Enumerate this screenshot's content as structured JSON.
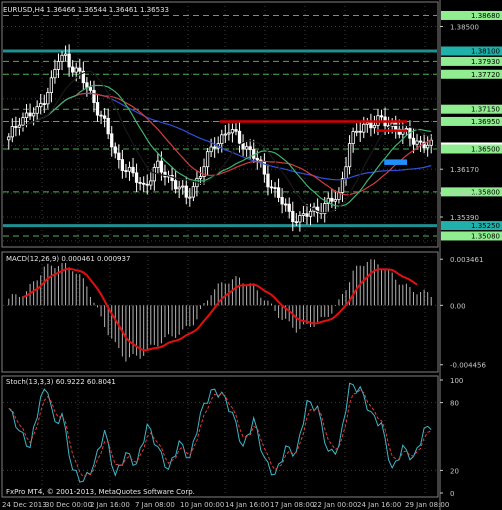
{
  "header": {
    "symbol_line": "EURUSD,H4  1.36466 1.36544 1.36461 1.36533"
  },
  "copyright": "FxPro MT4, © 2001-2013, MetaQuotes Software Corp.",
  "colors": {
    "background": "#000000",
    "grid": "#3c3c3c",
    "candle": "#ffffff",
    "level_teal": "#1f8f8f",
    "level_red": "#d40000",
    "zone_blue": "#1e90ff",
    "ma_red": "#d23c3c",
    "ma_blue": "#3050d8",
    "ma_green": "#3cb371",
    "ma_black": "#181818",
    "dashed_green": "#4caf50",
    "macd_hist": "#b4b4b4",
    "macd_signal": "#e01010",
    "stoch_main": "#3fb6c8",
    "stoch_signal": "#e03c3c"
  },
  "chart_data": [
    {
      "type": "candlestick",
      "panel": "price",
      "title": "EURUSD,H4",
      "ylim": [
        1.349,
        1.389
      ],
      "ticks_shown": [
        "1.38500",
        "1.36170",
        "1.35780",
        "1.35390"
      ],
      "price_boxes": [
        {
          "label": "1.38680",
          "color": "#90ee90"
        },
        {
          "label": "1.38100",
          "color": "#20b2aa"
        },
        {
          "label": "1.37930",
          "color": "#90ee90"
        },
        {
          "label": "1.37720",
          "color": "#90ee90"
        },
        {
          "label": "1.37150",
          "color": "#90ee90"
        },
        {
          "label": "1.36950",
          "color": "#90ee90"
        },
        {
          "label": "1.36533",
          "color": "#ffffff"
        },
        {
          "label": "1.36500",
          "color": "#90ee90"
        },
        {
          "label": "1.35800",
          "color": "#90ee90"
        },
        {
          "label": "1.35250",
          "color": "#20b2aa"
        },
        {
          "label": "1.35080",
          "color": "#90ee90"
        }
      ],
      "levels": [
        {
          "kind": "horizontal",
          "value": 1.381,
          "style": "solid",
          "color": "teal"
        },
        {
          "kind": "horizontal",
          "value": 1.3525,
          "style": "solid",
          "color": "teal"
        },
        {
          "kind": "segment",
          "value": 1.3695,
          "from": "14 Jan",
          "style": "solid",
          "color": "red"
        },
        {
          "kind": "segment",
          "value": 1.368,
          "from": "22 Jan",
          "style": "solid",
          "color": "red"
        },
        {
          "kind": "zone",
          "from_value": 1.3632,
          "to_value": 1.3625,
          "color": "blue"
        }
      ],
      "dashed_levels": [
        1.3868,
        1.3793,
        1.3772,
        1.3715,
        1.3695,
        1.365,
        1.358,
        1.3508
      ],
      "x_labels": [
        "24 Dec 2013",
        "30 Dec 00:00",
        "2 Jan 16:00",
        "7 Jan 08:00",
        "10 Jan 00:00",
        "14 Jan 16:00",
        "17 Jan 08:00",
        "22 Jan 00:00",
        "24 Jan 16:00",
        "29 Jan 08:00"
      ]
    },
    {
      "type": "line",
      "panel": "macd",
      "title": "MACD(12,26,9) 0.000461 0.000937",
      "ticks_shown": [
        "0.003461",
        "0.00",
        "-0.004456"
      ],
      "ylim": [
        -0.005,
        0.004
      ],
      "series": [
        {
          "name": "MACD",
          "kind": "histogram"
        },
        {
          "name": "Signal",
          "kind": "line"
        }
      ]
    },
    {
      "type": "line",
      "panel": "stochastic",
      "title": "Stoch(13,3,3) 60.9222 60.8041",
      "ylim": [
        0,
        100
      ],
      "ticks_shown": [
        "100",
        "80",
        "20",
        "0"
      ],
      "series": [
        {
          "name": "Main",
          "style": "solid"
        },
        {
          "name": "Signal",
          "style": "dashed"
        }
      ]
    }
  ]
}
